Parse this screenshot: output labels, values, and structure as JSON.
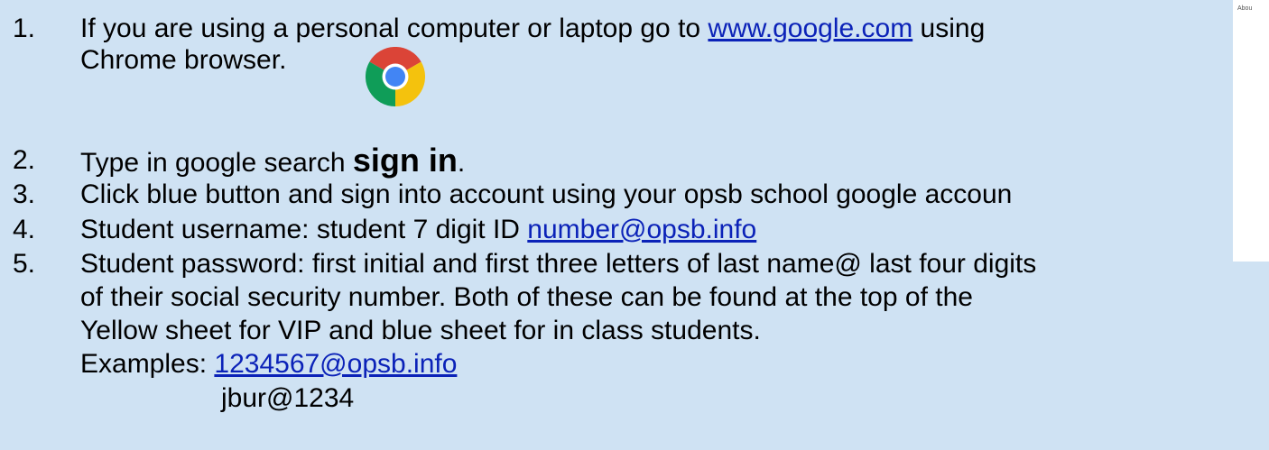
{
  "side_panel": {
    "about_label": "Abou"
  },
  "items": [
    {
      "number": "1.",
      "line1_pre": "If you are using a personal computer or laptop go to ",
      "line1_link": "www.google.com",
      "line1_post": " using",
      "line2": "Chrome browser."
    },
    {
      "number": "2.",
      "pre": "Type in google search ",
      "bold": "sign in",
      "post": "."
    },
    {
      "number": "3.",
      "text": "Click blue button and sign into account using your opsb school google accoun"
    },
    {
      "number": "4.",
      "pre": "Student username: student 7 digit ID ",
      "link": "number@opsb.info"
    },
    {
      "number": "5.",
      "line1": "Student password: first initial and first three letters of last name@ last four digits",
      "line2": "of their social security number. Both of these can be found at the top of the",
      "line3": "Yellow sheet for VIP and blue sheet for in class students.",
      "examples_label": "Examples: ",
      "example_link": "1234567@opsb.info",
      "example_password": "jbur@1234"
    }
  ],
  "colors": {
    "background": "#cfe2f3",
    "link": "#0b22b8"
  },
  "icons": {
    "browser_logo": "chrome-logo-icon"
  }
}
